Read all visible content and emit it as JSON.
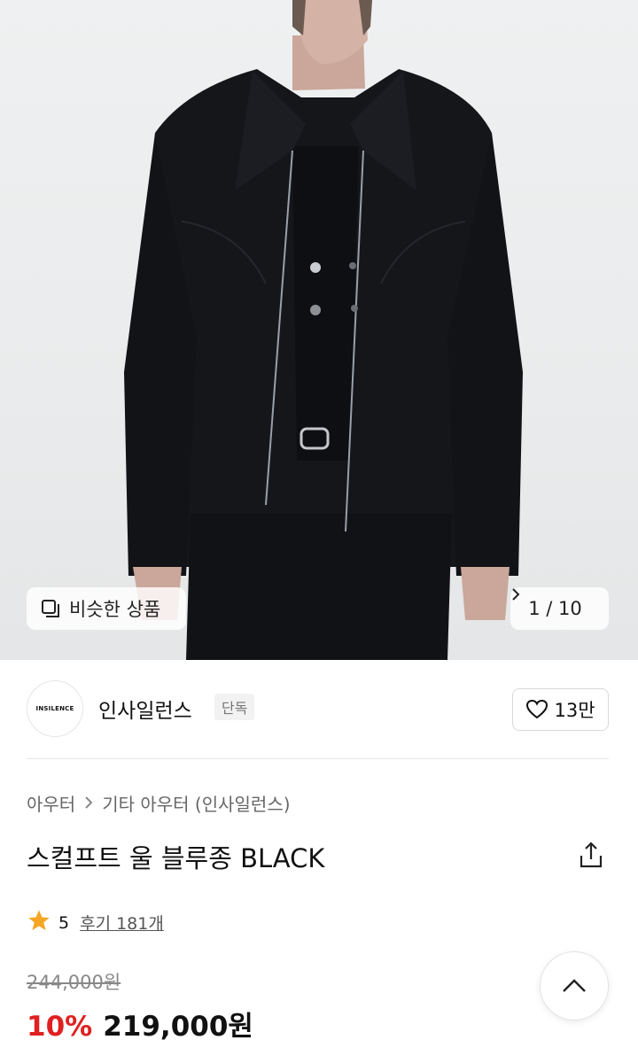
{
  "hero": {
    "similar_label": "비슷한 상품",
    "counter": "1 / 10",
    "similar_icon": "similar-items-icon",
    "next_icon": "chevron-right-icon"
  },
  "brand": {
    "logo_text": "INSILENCE",
    "name": "인사일런스",
    "tag": "단독",
    "likes": "13만"
  },
  "breadcrumb": {
    "items": [
      "아우터",
      "기타 아우터 (인사일런스)"
    ]
  },
  "product": {
    "title": "스컬프트 울 블루종 BLACK",
    "rating": "5",
    "reviews": "후기 181개",
    "original_price": "244,000원",
    "discount": "10%",
    "price": "219,000원"
  },
  "colors": {
    "discount": "#e02020",
    "star": "#f5a623"
  }
}
